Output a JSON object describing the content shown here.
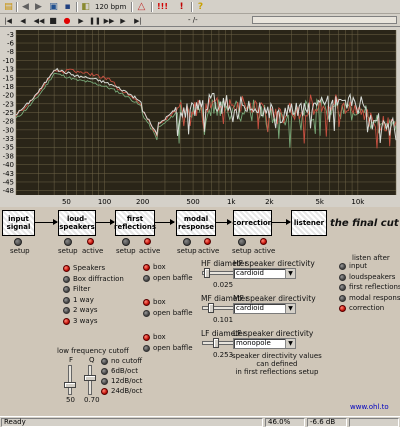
{
  "toolbar": {
    "tempo": "120 bpm",
    "time": "- /-"
  },
  "graph": {
    "y_ticks": [
      "-3",
      "-6",
      "-8",
      "-10",
      "-13",
      "-15",
      "-18",
      "-20",
      "-23",
      "-25",
      "-28",
      "-30",
      "-33",
      "-35",
      "-38",
      "-40",
      "-43",
      "-45",
      "-48"
    ],
    "x_ticks": [
      "50",
      "100",
      "200",
      "500",
      "1k",
      "2k",
      "5k",
      "10k"
    ]
  },
  "chain": {
    "blocks": [
      "input\nsignal",
      "loud-\nspeakers",
      "first\nreflections",
      "modal\nresponse",
      "correction",
      "listener"
    ],
    "tagline": "the final cut",
    "controls": [
      {
        "setup": "setup"
      },
      {
        "setup": "setup",
        "active": "active"
      },
      {
        "setup": "setup",
        "active": "active"
      },
      {
        "setup": "setup",
        "active": "active"
      },
      {
        "setup": "setup",
        "active": "active"
      }
    ]
  },
  "options": {
    "items": [
      "Speakers",
      "Box diffraction",
      "Filter",
      "1 way",
      "2 ways",
      "3 ways"
    ],
    "selected": [
      "Speakers",
      "3 ways"
    ]
  },
  "ways": {
    "box": "box",
    "open": "open baffle",
    "rows": [
      {
        "selected": "box"
      },
      {
        "selected": "box"
      },
      {
        "selected": "box"
      }
    ]
  },
  "diameters": [
    {
      "label": "HF diameter",
      "value": "0.025"
    },
    {
      "label": "MF diameter",
      "value": "0.101"
    },
    {
      "label": "LF diameter",
      "value": "0.253"
    }
  ],
  "directivity": [
    {
      "label": "HF speaker directivity",
      "value": "cardioid"
    },
    {
      "label": "MF speaker directivity",
      "value": "cardioid"
    },
    {
      "label": "LF speaker directivity",
      "value": "monopole"
    }
  ],
  "directivity_note": "speaker directivity values\ncan defined\nin first reflections setup",
  "lowfreq": {
    "title": "low frequency cutoff",
    "f_label": "F",
    "q_label": "Q",
    "f_value": "50",
    "q_value": "0.70",
    "options": [
      "no cutoff",
      "6dB/oct",
      "12dB/oct",
      "24dB/oct"
    ],
    "selected": "24dB/oct"
  },
  "listen": {
    "title": "listen after",
    "items": [
      "input",
      "loudspeakers",
      "first reflections",
      "modal response",
      "correction"
    ],
    "selected": "correction"
  },
  "website": "www.ohl.to",
  "status": {
    "state": "Ready",
    "zoom": "46.0%",
    "level": "-6.6 dB"
  },
  "colors": {
    "graph_bg": "#2a2518",
    "grid": "#6e6448",
    "curve_white": "#d8dcd8",
    "curve_red": "#c85040",
    "curve_green": "#78a878",
    "panel": "#cfc6b8",
    "led_on": "#d01810"
  }
}
